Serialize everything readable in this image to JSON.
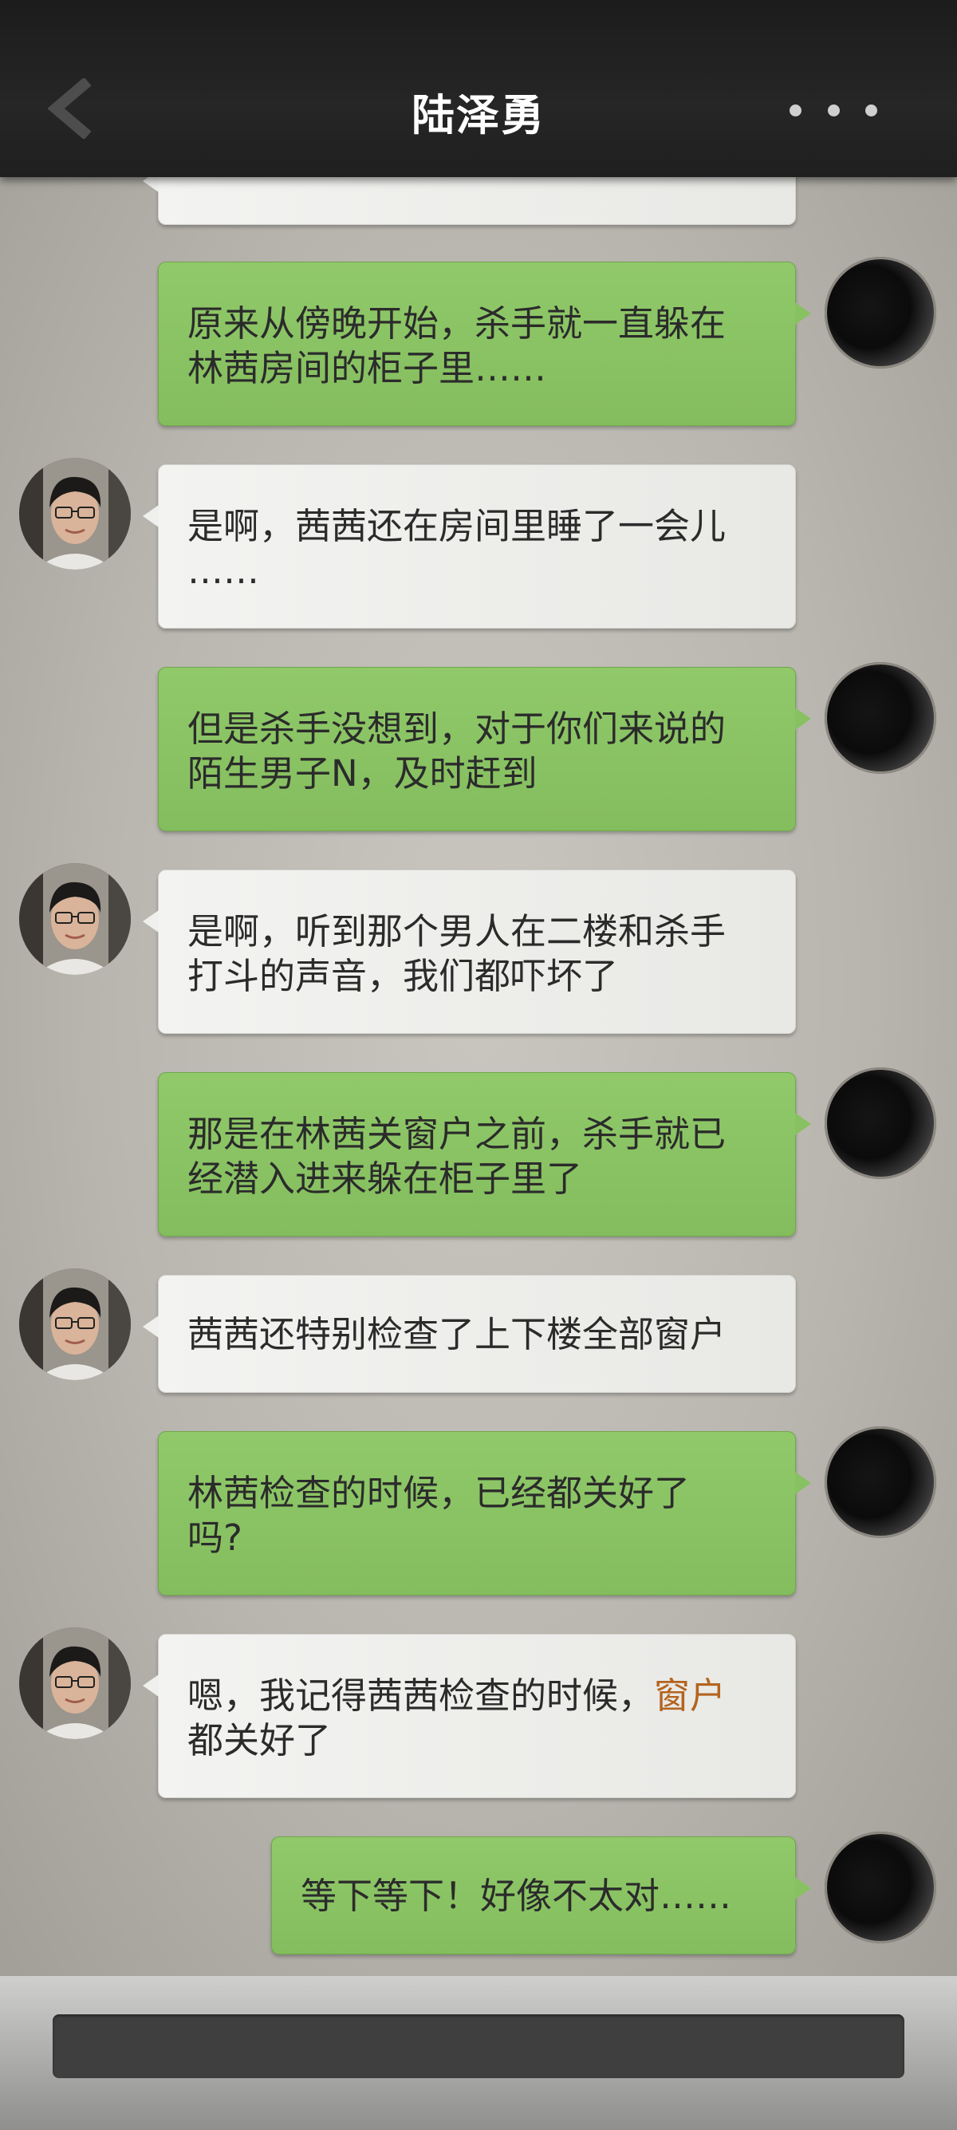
{
  "header": {
    "title": "陆泽勇",
    "back_icon": "back-chevron-icon",
    "more_icon": "more-dots-icon"
  },
  "messages": [
    {
      "side": "right",
      "avatar": "dark-avatar",
      "text_lines": [
        "原来从傍晚开始，杀手就一直躲在",
        "林茜房间的柜子里……"
      ]
    },
    {
      "side": "left",
      "avatar": "man-avatar",
      "text_lines": [
        "是啊，茜茜还在房间里睡了一会儿",
        "……"
      ]
    },
    {
      "side": "right",
      "avatar": "dark-avatar",
      "text_lines": [
        "但是杀手没想到，对于你们来说的",
        "陌生男子N，及时赶到"
      ]
    },
    {
      "side": "left",
      "avatar": "man-avatar",
      "text_lines": [
        "是啊，听到那个男人在二楼和杀手",
        "打斗的声音，我们都吓坏了"
      ]
    },
    {
      "side": "right",
      "avatar": "dark-avatar",
      "text_lines": [
        "那是在林茜关窗户之前，杀手就已",
        "经潜入进来躲在柜子里了"
      ]
    },
    {
      "side": "left",
      "avatar": "man-avatar",
      "text_lines": [
        "茜茜还特别检查了上下楼全部窗户"
      ]
    },
    {
      "side": "right",
      "avatar": "dark-avatar",
      "text_lines": [
        "林茜检查的时候，已经都关好了",
        "吗?"
      ]
    },
    {
      "side": "left",
      "avatar": "man-avatar",
      "text_lines": [
        "嗯，我记得茜茜检查的时候，",
        "都关好了"
      ],
      "highlight": "窗户",
      "highlight_color": "#b3641f"
    },
    {
      "side": "right",
      "avatar": "dark-avatar",
      "text_lines": [
        "等下等下！好像不太对……"
      ]
    }
  ],
  "colors": {
    "header_bg": "#1f1f1f",
    "green_bubble": "#88c161",
    "grey_bubble": "#efefed",
    "highlight": "#b3641f"
  }
}
